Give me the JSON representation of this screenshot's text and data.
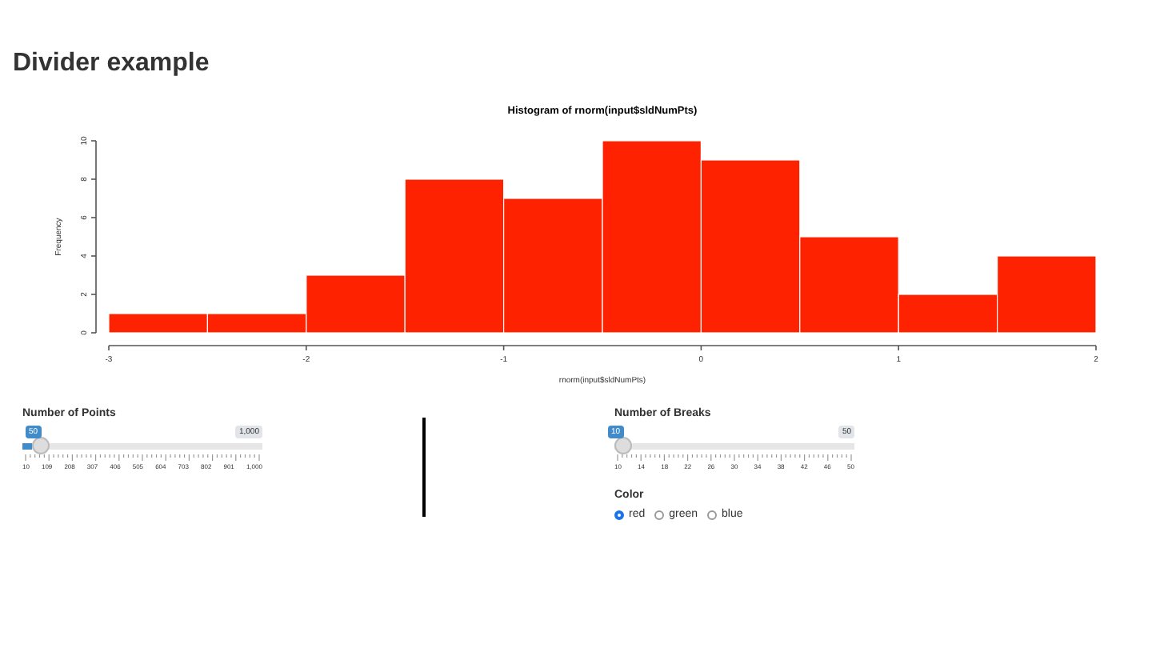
{
  "title": "Divider example",
  "plot": {
    "chart_data": {
      "type": "bar",
      "title": "Histogram of rnorm(input$sldNumPts)",
      "xlabel": "rnorm(input$sldNumPts)",
      "ylabel": "Frequency",
      "x": [
        -2.75,
        -2.25,
        -1.75,
        -1.25,
        -0.75,
        -0.25,
        0.25,
        0.75,
        1.25,
        1.75
      ],
      "series": [
        {
          "color": "#ff2200",
          "values": [
            1,
            1,
            3,
            8,
            7,
            10,
            9,
            5,
            2,
            4
          ]
        }
      ],
      "xlim": [
        -3,
        2
      ],
      "ylim": [
        0,
        10
      ],
      "xticks": [
        -3,
        -2,
        -1,
        0,
        1,
        2
      ],
      "yticks": [
        0,
        2,
        4,
        6,
        8,
        10
      ]
    }
  },
  "sliders": [
    {
      "label": "Number of Points",
      "value": "50",
      "max_label": "1,000",
      "level": 0.04,
      "ticks": [
        "10",
        "109",
        "208",
        "307",
        "406",
        "505",
        "604",
        "703",
        "802",
        "901",
        "1,000"
      ]
    },
    {
      "label": "Number of Breaks",
      "value": "10",
      "max_label": "50",
      "level": 0,
      "ticks": [
        "10",
        "14",
        "18",
        "22",
        "26",
        "30",
        "34",
        "38",
        "42",
        "46",
        "50"
      ]
    }
  ],
  "color_input": {
    "label": "Color",
    "options": [
      {
        "label": "red",
        "selected": true
      },
      {
        "label": "green",
        "selected": false
      },
      {
        "label": "blue",
        "selected": false
      }
    ]
  }
}
